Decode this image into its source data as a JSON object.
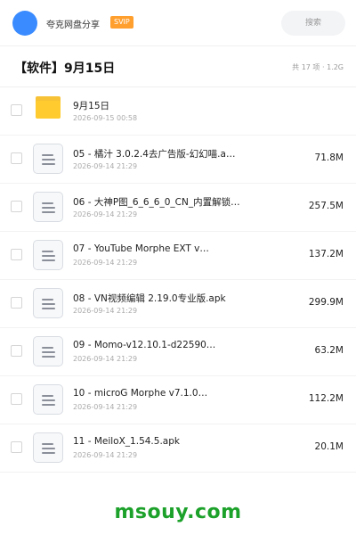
{
  "topbar": {
    "user_name": "夸克网盘分享",
    "vip_label": "SVIP",
    "search_label": "搜索"
  },
  "header": {
    "title": "【软件】9月15日",
    "meta": "共 17 项 · 1.2G"
  },
  "files": [
    {
      "type": "folder",
      "name": "9月15日",
      "date": "2026-09-15 00:58",
      "size": ""
    },
    {
      "type": "file",
      "name": "05 - 橘汁 3.0.2.4去广告版-幻幻喵.a…",
      "date": "2026-09-14 21:29",
      "size": "71.8M"
    },
    {
      "type": "file",
      "name": "06 - 大神P图_6_6_6_0_CN_内置解锁…",
      "date": "2026-09-14 21:29",
      "size": "257.5M"
    },
    {
      "type": "file",
      "name": "07 - YouTube Morphe EXT v…",
      "date": "2026-09-14 21:29",
      "size": "137.2M"
    },
    {
      "type": "file",
      "name": "08 - VN视频编辑 2.19.0专业版.apk",
      "date": "2026-09-14 21:29",
      "size": "299.9M"
    },
    {
      "type": "file",
      "name": "09 - Momo-v12.10.1-d22590…",
      "date": "2026-09-14 21:29",
      "size": "63.2M"
    },
    {
      "type": "file",
      "name": "10 - microG Morphe v7.1.0…",
      "date": "2026-09-14 21:29",
      "size": "112.2M"
    },
    {
      "type": "file",
      "name": "11 - MeiloX_1.54.5.apk",
      "date": "2026-09-14 21:29",
      "size": "20.1M"
    }
  ],
  "watermark": "msouy.com",
  "colors": {
    "accent": "#3a8bff",
    "vip": "#ff9f2e",
    "folder": "#ffcb2f",
    "watermark": "#1ca12a"
  }
}
